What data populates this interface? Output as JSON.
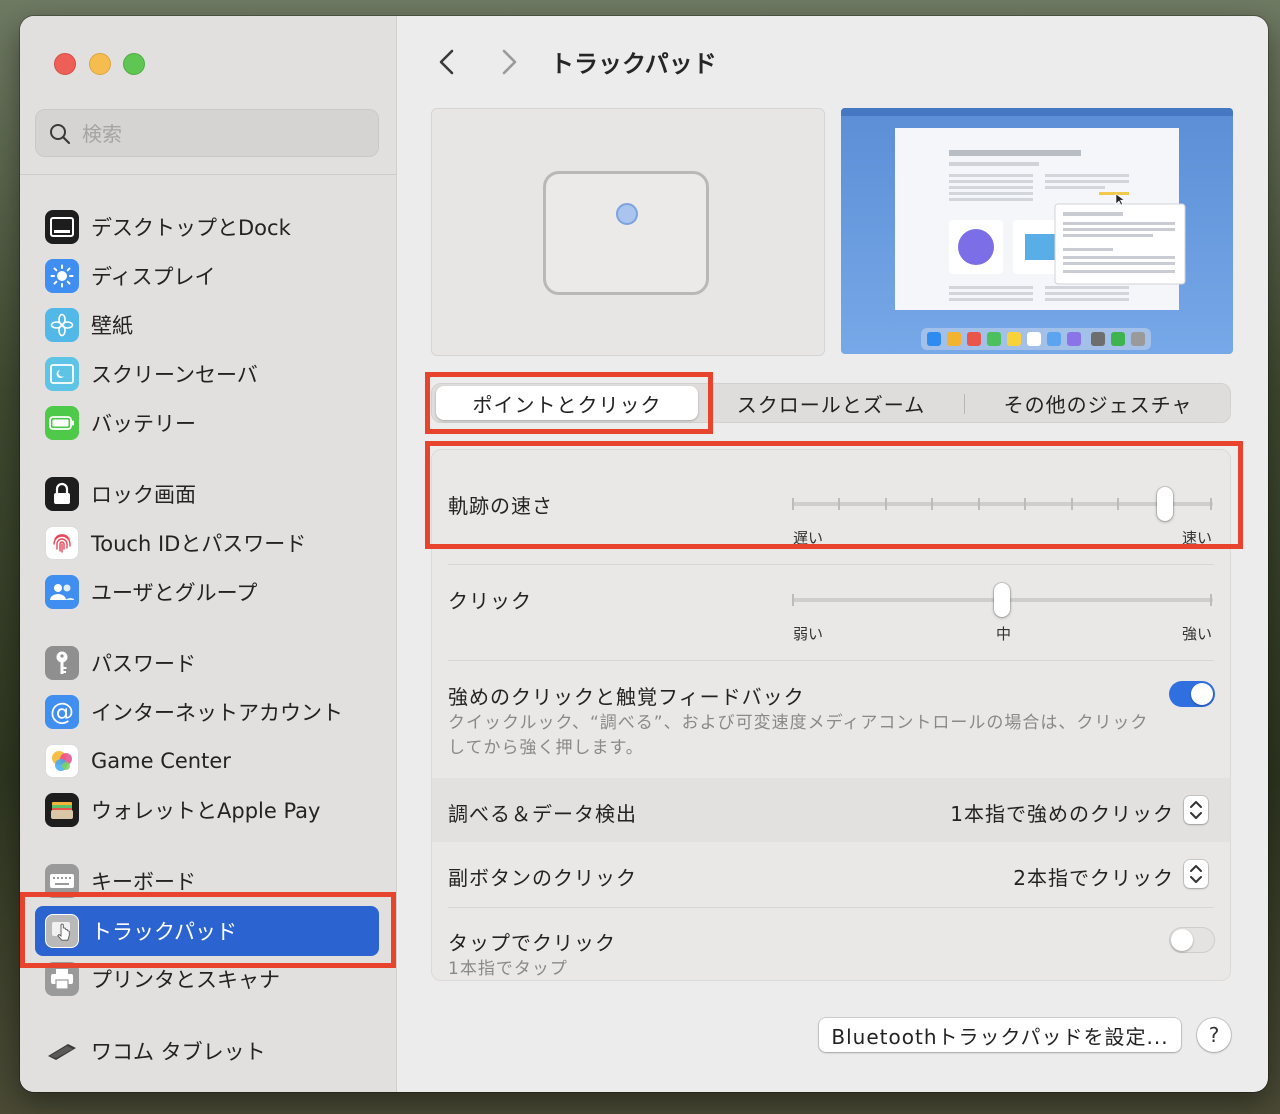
{
  "search": {
    "placeholder": "検索"
  },
  "sidebar": {
    "items": [
      {
        "label": "デスクトップとDock"
      },
      {
        "label": "ディスプレイ"
      },
      {
        "label": "壁紙"
      },
      {
        "label": "スクリーンセーバ"
      },
      {
        "label": "バッテリー"
      },
      {
        "label": "ロック画面"
      },
      {
        "label": "Touch IDとパスワード"
      },
      {
        "label": "ユーザとグループ"
      },
      {
        "label": "パスワード"
      },
      {
        "label": "インターネットアカウント"
      },
      {
        "label": "Game Center"
      },
      {
        "label": "ウォレットとApple Pay"
      },
      {
        "label": "キーボード"
      },
      {
        "label": "トラックパッド"
      },
      {
        "label": "プリンタとスキャナ"
      },
      {
        "label": "ワコム タブレット"
      }
    ]
  },
  "main": {
    "title": "トラックパッド",
    "tabs": [
      {
        "label": "ポイントとクリック"
      },
      {
        "label": "スクロールとズーム"
      },
      {
        "label": "その他のジェスチャ"
      }
    ],
    "tracking": {
      "label": "軌跡の速さ",
      "min_label": "遅い",
      "max_label": "速い",
      "value": 8,
      "steps": 10
    },
    "click": {
      "label": "クリック",
      "min_label": "弱い",
      "mid_label": "中",
      "max_label": "強い",
      "value": 1,
      "steps": 3
    },
    "force_click": {
      "label": "強めのクリックと触覚フィードバック",
      "desc_line1": "クイックルック、“調べる”、および可変速度メディアコントロールの場合は、クリック",
      "desc_line2": "してから強く押します。",
      "enabled": true
    },
    "lookup": {
      "label": "調べる＆データ検出",
      "value": "1本指で強めのクリック"
    },
    "secondary": {
      "label": "副ボタンのクリック",
      "value": "2本指でクリック"
    },
    "tap": {
      "label": "タップでクリック",
      "sub": "1本指でタップ",
      "enabled": false
    },
    "bt_button": "Bluetoothトラックパッドを設定...",
    "help": "?"
  },
  "colors": {
    "accent": "#2b64d0",
    "highlight": "#e8432d"
  }
}
